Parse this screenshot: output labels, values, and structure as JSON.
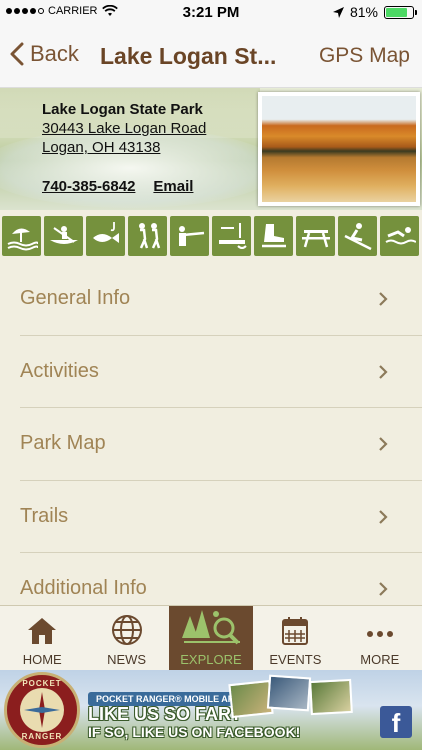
{
  "status_bar": {
    "carrier": "CARRIER",
    "time": "3:21 PM",
    "battery": "81%",
    "battery_level": 0.81
  },
  "nav": {
    "back_label": "Back",
    "title": "Lake Logan St...",
    "gps_label": "GPS Map"
  },
  "park": {
    "name": "Lake Logan State Park",
    "address_line1": "30443 Lake Logan Road",
    "address_line2": "Logan, OH 43138",
    "phone": "740-385-6842",
    "email_label": "Email"
  },
  "activities": [
    {
      "icon": "beach-icon"
    },
    {
      "icon": "canoe-icon"
    },
    {
      "icon": "fishing-icon"
    },
    {
      "icon": "hiking-icon"
    },
    {
      "icon": "hunting-icon"
    },
    {
      "icon": "ice-fishing-icon"
    },
    {
      "icon": "ice-skating-icon"
    },
    {
      "icon": "picnic-icon"
    },
    {
      "icon": "sledding-icon"
    },
    {
      "icon": "swimming-icon"
    }
  ],
  "menu": [
    {
      "label": "General Info"
    },
    {
      "label": "Activities"
    },
    {
      "label": "Park Map"
    },
    {
      "label": "Trails"
    },
    {
      "label": "Additional Info"
    }
  ],
  "tabs": [
    {
      "label": "HOME",
      "icon": "home-icon"
    },
    {
      "label": "NEWS",
      "icon": "globe-icon"
    },
    {
      "label": "EXPLORE",
      "icon": "explore-icon",
      "active": true
    },
    {
      "label": "EVENTS",
      "icon": "calendar-icon"
    },
    {
      "label": "MORE",
      "icon": "more-icon"
    }
  ],
  "ad": {
    "logo_text_top": "POCKET",
    "logo_text_bottom": "RANGER",
    "tagline": "POCKET RANGER® MOBILE APP",
    "line1": "LIKE US SO FAR?",
    "line2": "IF SO, LIKE US ON FACEBOOK!",
    "fb": "f"
  },
  "colors": {
    "brown": "#6a4526",
    "olive_green": "#75913d",
    "menu_text": "#a08455",
    "background": "#f1eee0"
  }
}
